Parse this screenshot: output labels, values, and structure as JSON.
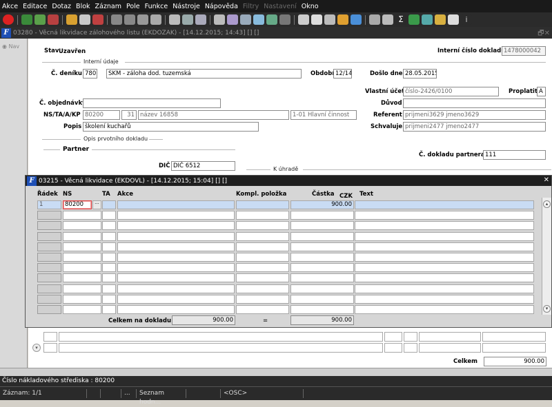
{
  "menu": [
    "Akce",
    "Editace",
    "Dotaz",
    "Blok",
    "Záznam",
    "Pole",
    "Funkce",
    "Nástroje",
    "Nápověda",
    "Filtry",
    "Nastavení",
    "Okno"
  ],
  "menu_disabled": [
    "Filtry",
    "Nastavení"
  ],
  "main_window": {
    "title": "03280 - Věcná likvidace zálohového listu (EKDOZAK) - [14.12.2015; 14:43] [] []",
    "controls": "🗗✕"
  },
  "nav_label": "◉ Nav",
  "header": {
    "stav_label": "Stav",
    "stav_value": "Uzavřen",
    "interni_cislo_label": "Interní číslo dokladu",
    "interni_cislo_value": "1478000042",
    "interni_udaje_label": "Interní údaje",
    "denik_label": "Č. deníku",
    "denik_value": "780",
    "denik_name": "SKM - záloha dod. tuzemská",
    "obdobi_label": "Období",
    "obdobi_value": "12/14",
    "doslo_label": "Došlo dne",
    "doslo_value": "28.05.2015",
    "vlastni_ucet_label": "Vlastní účet",
    "vlastni_ucet_value": "číslo-2426/0100",
    "proplatit_label": "Proplatit",
    "proplatit_value": "A",
    "objednavky_label": "Č. objednávky",
    "objednavky_value": "",
    "duvod_label": "Důvod",
    "duvod_value": "",
    "nstakp_label": "NS/TA/A/KP",
    "ns_value": "80200",
    "ta_value": "31",
    "akce_value": "název 16858",
    "kp_value": "1-01 Hlavní činnost",
    "referent_label": "Referent",
    "referent_value": "prijmeni3629 jmeno3629",
    "popis_label": "Popis",
    "popis_value": "školení kuchařů",
    "schvaluje_label": "Schvaluje",
    "schvaluje_value": "prijmeni2477 jmeno2477",
    "opis_label": "Opis prvotního dokladu",
    "partner_label": "Partner",
    "cislo_partnera_label": "Č. dokladu partnera",
    "cislo_partnera_value": "111",
    "dic_label": "DIČ",
    "dic_value": "DIČ 6512",
    "k_uhrade_label": "K úhradě",
    "celkem_label": "Celkem",
    "celkem_value": "900.00"
  },
  "dialog": {
    "title": "03215 - Věcná likvidace (EKDOVL) - [14.12.2015; 15:04] [] []",
    "close": "✕",
    "columns": {
      "radek": "Řádek",
      "ns": "NS",
      "ta": "TA",
      "akce": "Akce",
      "kompl": "Kompl. položka",
      "castka": "Částka",
      "czk": "CZK",
      "text": "Text"
    },
    "row1": {
      "radek": "1",
      "ns": "80200",
      "lov": "···",
      "castka": "900.00"
    },
    "celkem_label": "Celkem na dokladu",
    "celkem_value": "900.00",
    "equals": "=",
    "celkem_value2": "900.00"
  },
  "status": {
    "line1": "Číslo nákladového střediska : 80200",
    "zaznam": "Záznam: 1/1",
    "dots": "...",
    "seznam": "Seznam hodn...",
    "osc": "<OSC>"
  }
}
